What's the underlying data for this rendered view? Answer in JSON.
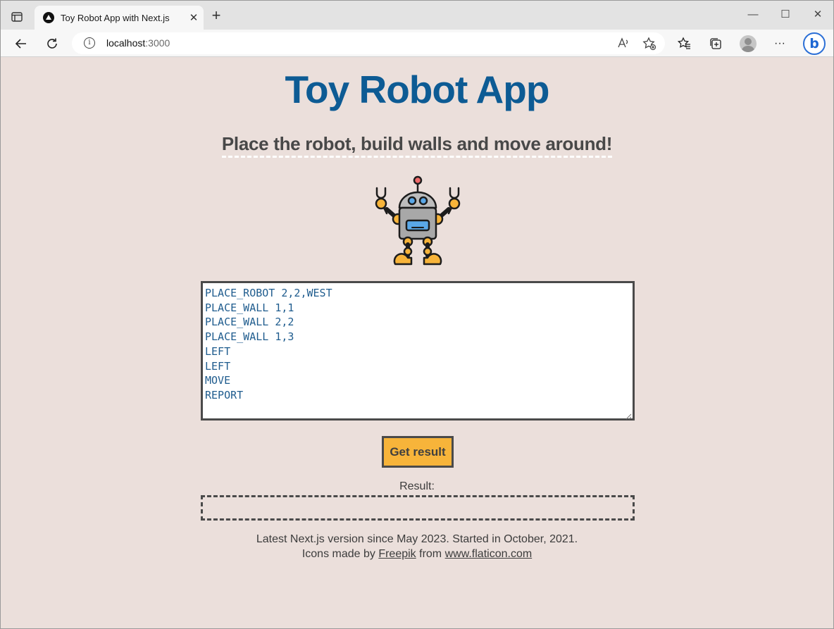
{
  "browser": {
    "tab_title": "Toy Robot App with Next.js",
    "tab_close": "✕",
    "new_tab": "+",
    "window_controls": {
      "minimize": "—",
      "maximize": "☐",
      "close": "✕"
    },
    "address_host": "localhost",
    "address_port": ":3000",
    "more_label": "···",
    "bing_label": "b"
  },
  "page": {
    "title": "Toy Robot App",
    "subtitle": "Place the robot, build walls and move around!",
    "commands": [
      "PLACE_ROBOT 2,2,WEST",
      "PLACE_WALL 1,1",
      "PLACE_WALL 2,2",
      "PLACE_WALL 1,3",
      "LEFT",
      "LEFT",
      "MOVE",
      "REPORT"
    ],
    "button_label": "Get result",
    "result_label": "Result:",
    "result_value": "",
    "footer_line1": "Latest Next.js version since May 2023. Started in October, 2021.",
    "footer_icons_prefix": "Icons made by ",
    "footer_link1": "Freepik",
    "footer_middle": " from ",
    "footer_link2": "www.flaticon.com"
  },
  "colors": {
    "page_bg": "#ebdfdb",
    "title": "#0d5b94",
    "button_bg": "#f7b43a",
    "command_text": "#1f5c8e"
  },
  "icons": [
    "tab-actions-icon",
    "back-arrow-icon",
    "reload-icon",
    "info-icon",
    "read-aloud-icon",
    "add-favorite-icon",
    "favorites-icon",
    "collections-icon",
    "profile-icon",
    "more-icon",
    "bing-icon",
    "robot-icon"
  ]
}
